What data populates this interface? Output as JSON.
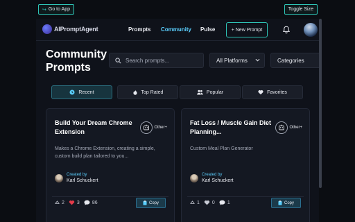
{
  "frame": {
    "go_to_app": "Go to App",
    "toggle_size": "Toggle Size"
  },
  "nav": {
    "logo": "AIPromptAgent",
    "links": [
      "Prompts",
      "Community",
      "Pulse"
    ],
    "active_link": "Community",
    "new_prompt": "+ New Prompt"
  },
  "header": {
    "title": "Community Prompts",
    "search_placeholder": "Search prompts...",
    "platform_select": "All Platforms",
    "categories_select": "Categories"
  },
  "tabs": [
    {
      "label": "Recent",
      "icon": "clock-icon",
      "active": true
    },
    {
      "label": "Top Rated",
      "icon": "fire-icon",
      "active": false
    },
    {
      "label": "Popular",
      "icon": "users-icon",
      "active": false
    },
    {
      "label": "Favorites",
      "icon": "heart-icon",
      "active": false
    }
  ],
  "cards": [
    {
      "title": "Build Your Dream Chrome Extension",
      "platform": "Other+",
      "description": "Makes a Chrome Extension, creating a simple, custom build plan tailored to you...",
      "created_by_label": "Created by",
      "author": "Karl Schuckert",
      "upvotes": "2",
      "likes": "3",
      "comments": "86",
      "copy": "Copy"
    },
    {
      "title": "Fat Loss / Muscle Gain Diet Planning...",
      "platform": "Other+",
      "description": "Custom Meal Plan Generator",
      "created_by_label": "Created by",
      "author": "Karl Schuckert",
      "upvotes": "1",
      "likes": "0",
      "comments": "1",
      "copy": "Copy"
    }
  ],
  "colors": {
    "accent": "#2ec4b6",
    "link_active": "#5bd0ff",
    "heart": "#e53b4a",
    "background": "#0f121a"
  }
}
